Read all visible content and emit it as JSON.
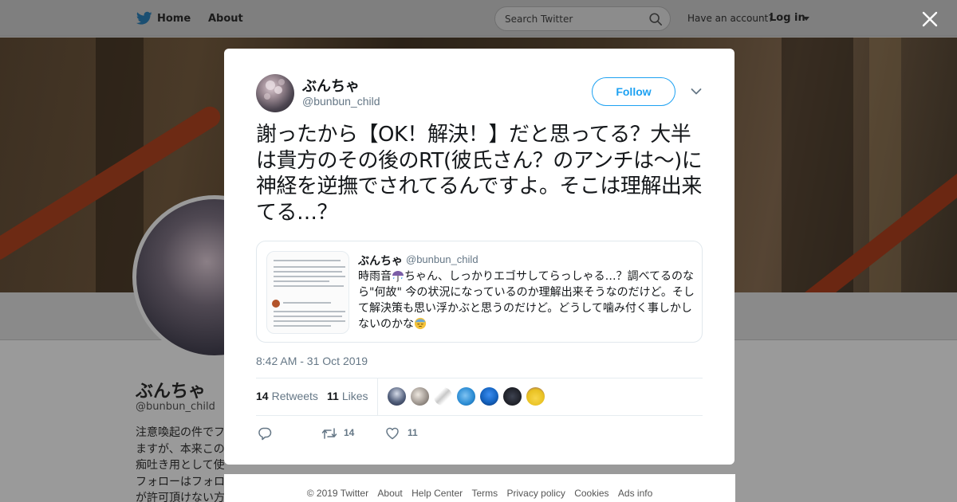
{
  "topbar": {
    "home_label": "Home",
    "about_label": "About",
    "search_placeholder": "Search Twitter",
    "have_account": "Have an account?",
    "login_label": "Log in"
  },
  "profile": {
    "name": "ぶんちゃ",
    "handle": "@bunbun_child",
    "bio_lines": [
      "注意喚起の件でフ",
      "ますが、本来この",
      "痴吐き用として使",
      "フォローはフォロ",
      "が許可頂けない方"
    ]
  },
  "tweet": {
    "author_name": "ぶんちゃ",
    "author_handle": "@bunbun_child",
    "follow_label": "Follow",
    "text": "謝ったから【OK！解決！】だと思ってる？大半は貴方のその後のRT(彼氏さん？のアンチは〜)に神経を逆撫でされてるんですよ。そこは理解出来てる…？",
    "quoted": {
      "name": "ぶんちゃ",
      "handle": "@bunbun_child",
      "text_before_emoji": "時雨音",
      "text_middle": "ちゃん、しっかりエゴサしてらっしゃる…？調べてるのなら\"何故\" 今の状況になっているのか理解出来そうなのだけど。そして解決策も思い浮かぶと思うのだけど。どうして噛み付く事しかしないのかな",
      "emoji_umbrella": "umbrella-rain-emoji",
      "emoji_face": "sleepy-sweat-face-emoji"
    },
    "timestamp": "8:42 AM - 31 Oct 2019",
    "retweets_count": "14",
    "retweets_label": "Retweets",
    "likes_count": "11",
    "likes_label": "Likes",
    "likers_colors": [
      "#2b3a5a",
      "#b9b4ae",
      "#e8e8e8",
      "#2a8bd3",
      "#1463c0",
      "#1d1f26",
      "#e8c020"
    ],
    "actions": {
      "reply_count": "",
      "retweet_count": "14",
      "like_count": "11"
    }
  },
  "footer": {
    "links": [
      "© 2019 Twitter",
      "About",
      "Help Center",
      "Terms",
      "Privacy policy",
      "Cookies",
      "Ads info"
    ]
  },
  "colors": {
    "accent": "#1da1f2",
    "text_primary": "#14171a",
    "text_secondary": "#657786",
    "overlay": "#9a9a9a"
  }
}
